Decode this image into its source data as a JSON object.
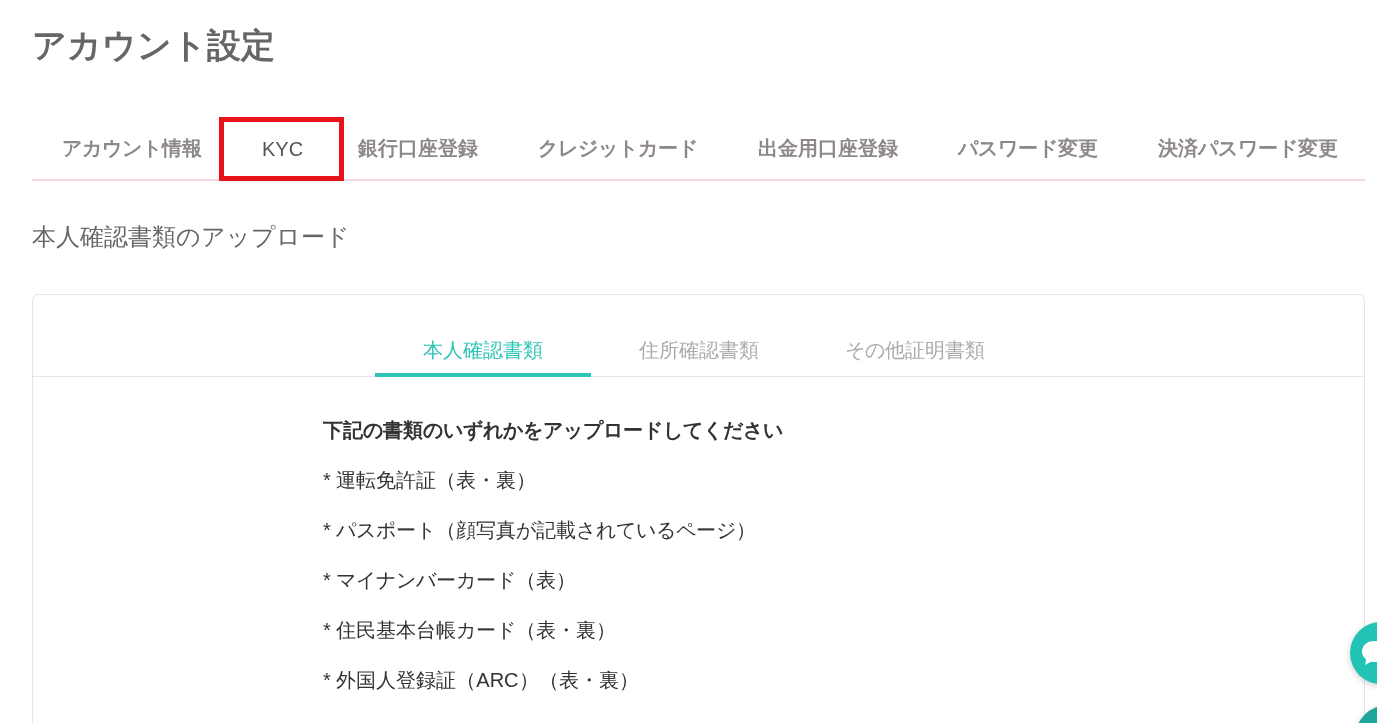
{
  "page": {
    "title": "アカウント設定"
  },
  "tabs": [
    {
      "label": "アカウント情報",
      "selected": false,
      "highlighted": false
    },
    {
      "label": "KYC",
      "selected": true,
      "highlighted": true
    },
    {
      "label": "銀行口座登録",
      "selected": false,
      "highlighted": false
    },
    {
      "label": "クレジットカード",
      "selected": false,
      "highlighted": false
    },
    {
      "label": "出金用口座登録",
      "selected": false,
      "highlighted": false
    },
    {
      "label": "パスワード変更",
      "selected": false,
      "highlighted": false
    },
    {
      "label": "決済パスワード変更",
      "selected": false,
      "highlighted": false
    }
  ],
  "section": {
    "title": "本人確認書類のアップロード"
  },
  "document_tabs": [
    {
      "label": "本人確認書類",
      "selected": true
    },
    {
      "label": "住所確認書類",
      "selected": false
    },
    {
      "label": "その他証明書類",
      "selected": false
    }
  ],
  "instructions": {
    "heading": "下記の書類のいずれかをアップロードしてください",
    "items": [
      "* 運転免許証（表・裏）",
      "* パスポート（顔写真が記載されているページ）",
      "* マイナンバーカード（表）",
      "* 住民基本台帳カード（表・裏）",
      "* 外国人登録証（ARC）（表・裏）"
    ]
  },
  "floating_buttons": [
    {
      "kind": "chat"
    },
    {
      "kind": "plain"
    }
  ]
}
